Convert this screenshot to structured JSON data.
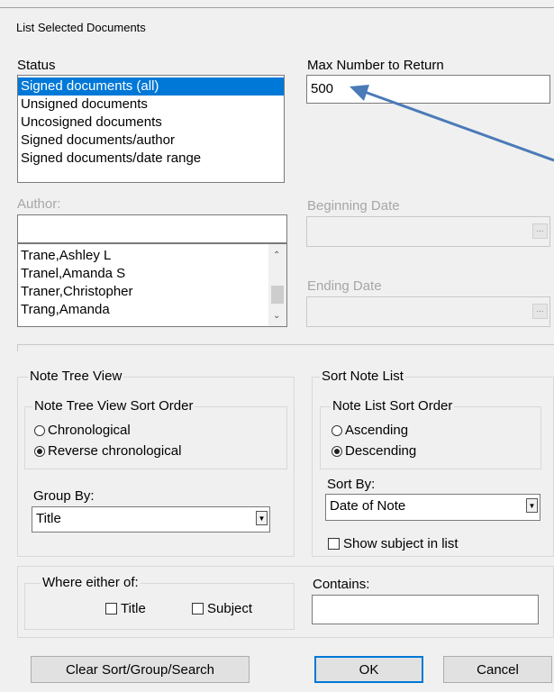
{
  "dialog": {
    "title": "List Selected Documents"
  },
  "status": {
    "label": "Status",
    "items": [
      "Signed documents (all)",
      "Unsigned documents",
      "Uncosigned documents",
      "Signed documents/author",
      "Signed documents/date range"
    ],
    "selected_index": 0
  },
  "max_number": {
    "label": "Max Number to Return",
    "value": "500"
  },
  "author": {
    "label": "Author:",
    "search_value": "",
    "items": [
      "Trane,Ashley L",
      "Tranel,Amanda S",
      "Traner,Christopher",
      "Trang,Amanda"
    ]
  },
  "beginning_date": {
    "label": "Beginning Date",
    "value": "",
    "button": "..."
  },
  "ending_date": {
    "label": "Ending Date",
    "value": "",
    "button": "..."
  },
  "note_tree_view": {
    "legend": "Note Tree View",
    "sort_order_legend": "Note Tree View Sort Order",
    "options": [
      "Chronological",
      "Reverse chronological"
    ],
    "selected": "Reverse chronological",
    "group_by_label": "Group By:",
    "group_by_value": "Title"
  },
  "sort_note_list": {
    "legend": "Sort Note List",
    "sort_order_legend": "Note List Sort Order",
    "options": [
      "Ascending",
      "Descending"
    ],
    "selected": "Descending",
    "sort_by_label": "Sort By:",
    "sort_by_value": "Date of Note",
    "show_subject_label": "Show subject in list",
    "show_subject_checked": false
  },
  "search": {
    "where_legend": "Where either of:",
    "title_label": "Title",
    "subject_label": "Subject",
    "title_checked": false,
    "subject_checked": false,
    "contains_label": "Contains:",
    "contains_value": ""
  },
  "buttons": {
    "clear": "Clear Sort/Group/Search",
    "ok": "OK",
    "cancel": "Cancel"
  },
  "colors": {
    "selection": "#0078d7",
    "annotation_arrow": "#4a7ab8"
  }
}
